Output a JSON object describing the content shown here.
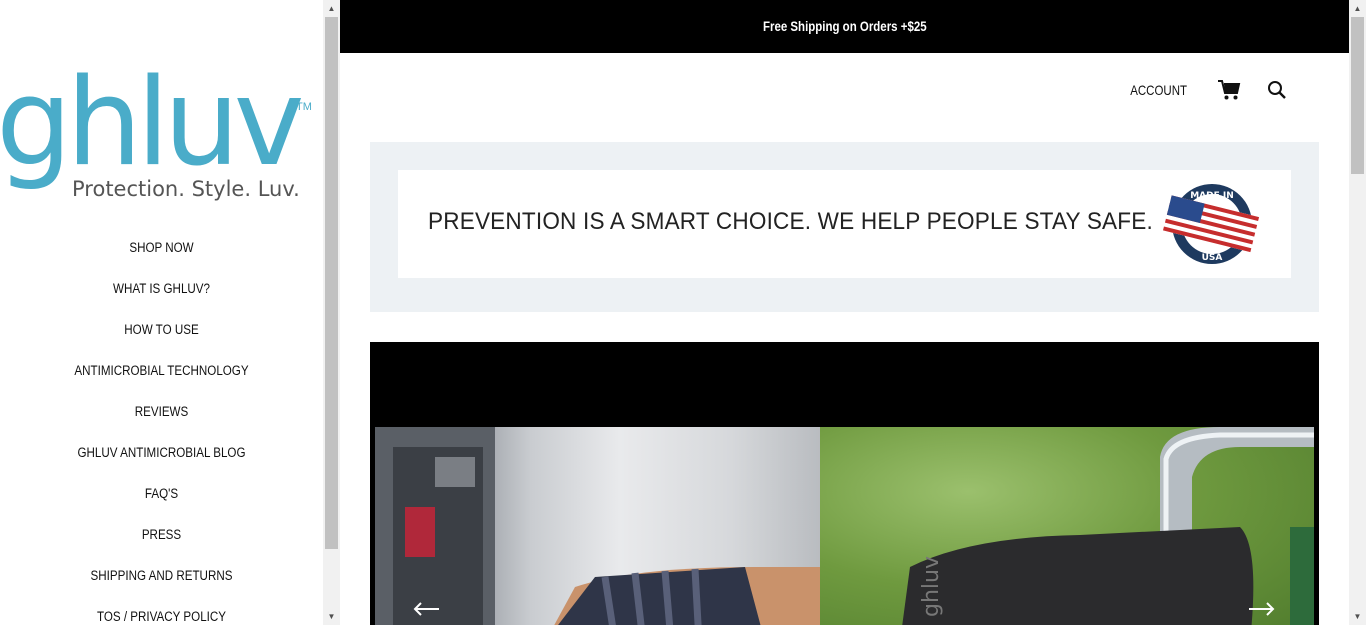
{
  "logo": {
    "wordmark": "ghluv",
    "trademark": "TM",
    "tagline": "Protection. Style. Luv."
  },
  "nav": {
    "items": [
      {
        "label": "SHOP NOW"
      },
      {
        "label": "WHAT IS GHLUV?"
      },
      {
        "label": "HOW TO USE"
      },
      {
        "label": "ANTIMICROBIAL TECHNOLOGY"
      },
      {
        "label": "REVIEWS"
      },
      {
        "label": "GHLUV ANTIMICROBIAL BLOG"
      },
      {
        "label": "FAQ'S"
      },
      {
        "label": "PRESS"
      },
      {
        "label": "SHIPPING AND RETURNS"
      },
      {
        "label": "TOS / PRIVACY POLICY"
      }
    ]
  },
  "announcement": {
    "text": "Free Shipping on Orders +$25"
  },
  "header": {
    "account_label": "ACCOUNT",
    "cart_icon": "cart-icon",
    "search_icon": "search-icon"
  },
  "banner": {
    "text": "PREVENTION IS A SMART CHOICE.  WE HELP PEOPLE STAY SAFE.",
    "badge_top": "MADE IN",
    "badge_bottom": "USA"
  },
  "slider": {
    "prev_icon": "arrow-left-icon",
    "next_icon": "arrow-right-icon",
    "glove_brand": "ghluv"
  },
  "colors": {
    "brand": "#4aacc9",
    "tagline": "#555555",
    "announcement_bg": "#000000",
    "banner_bg": "#edf1f4",
    "badge_navy": "#1e3a5f"
  }
}
